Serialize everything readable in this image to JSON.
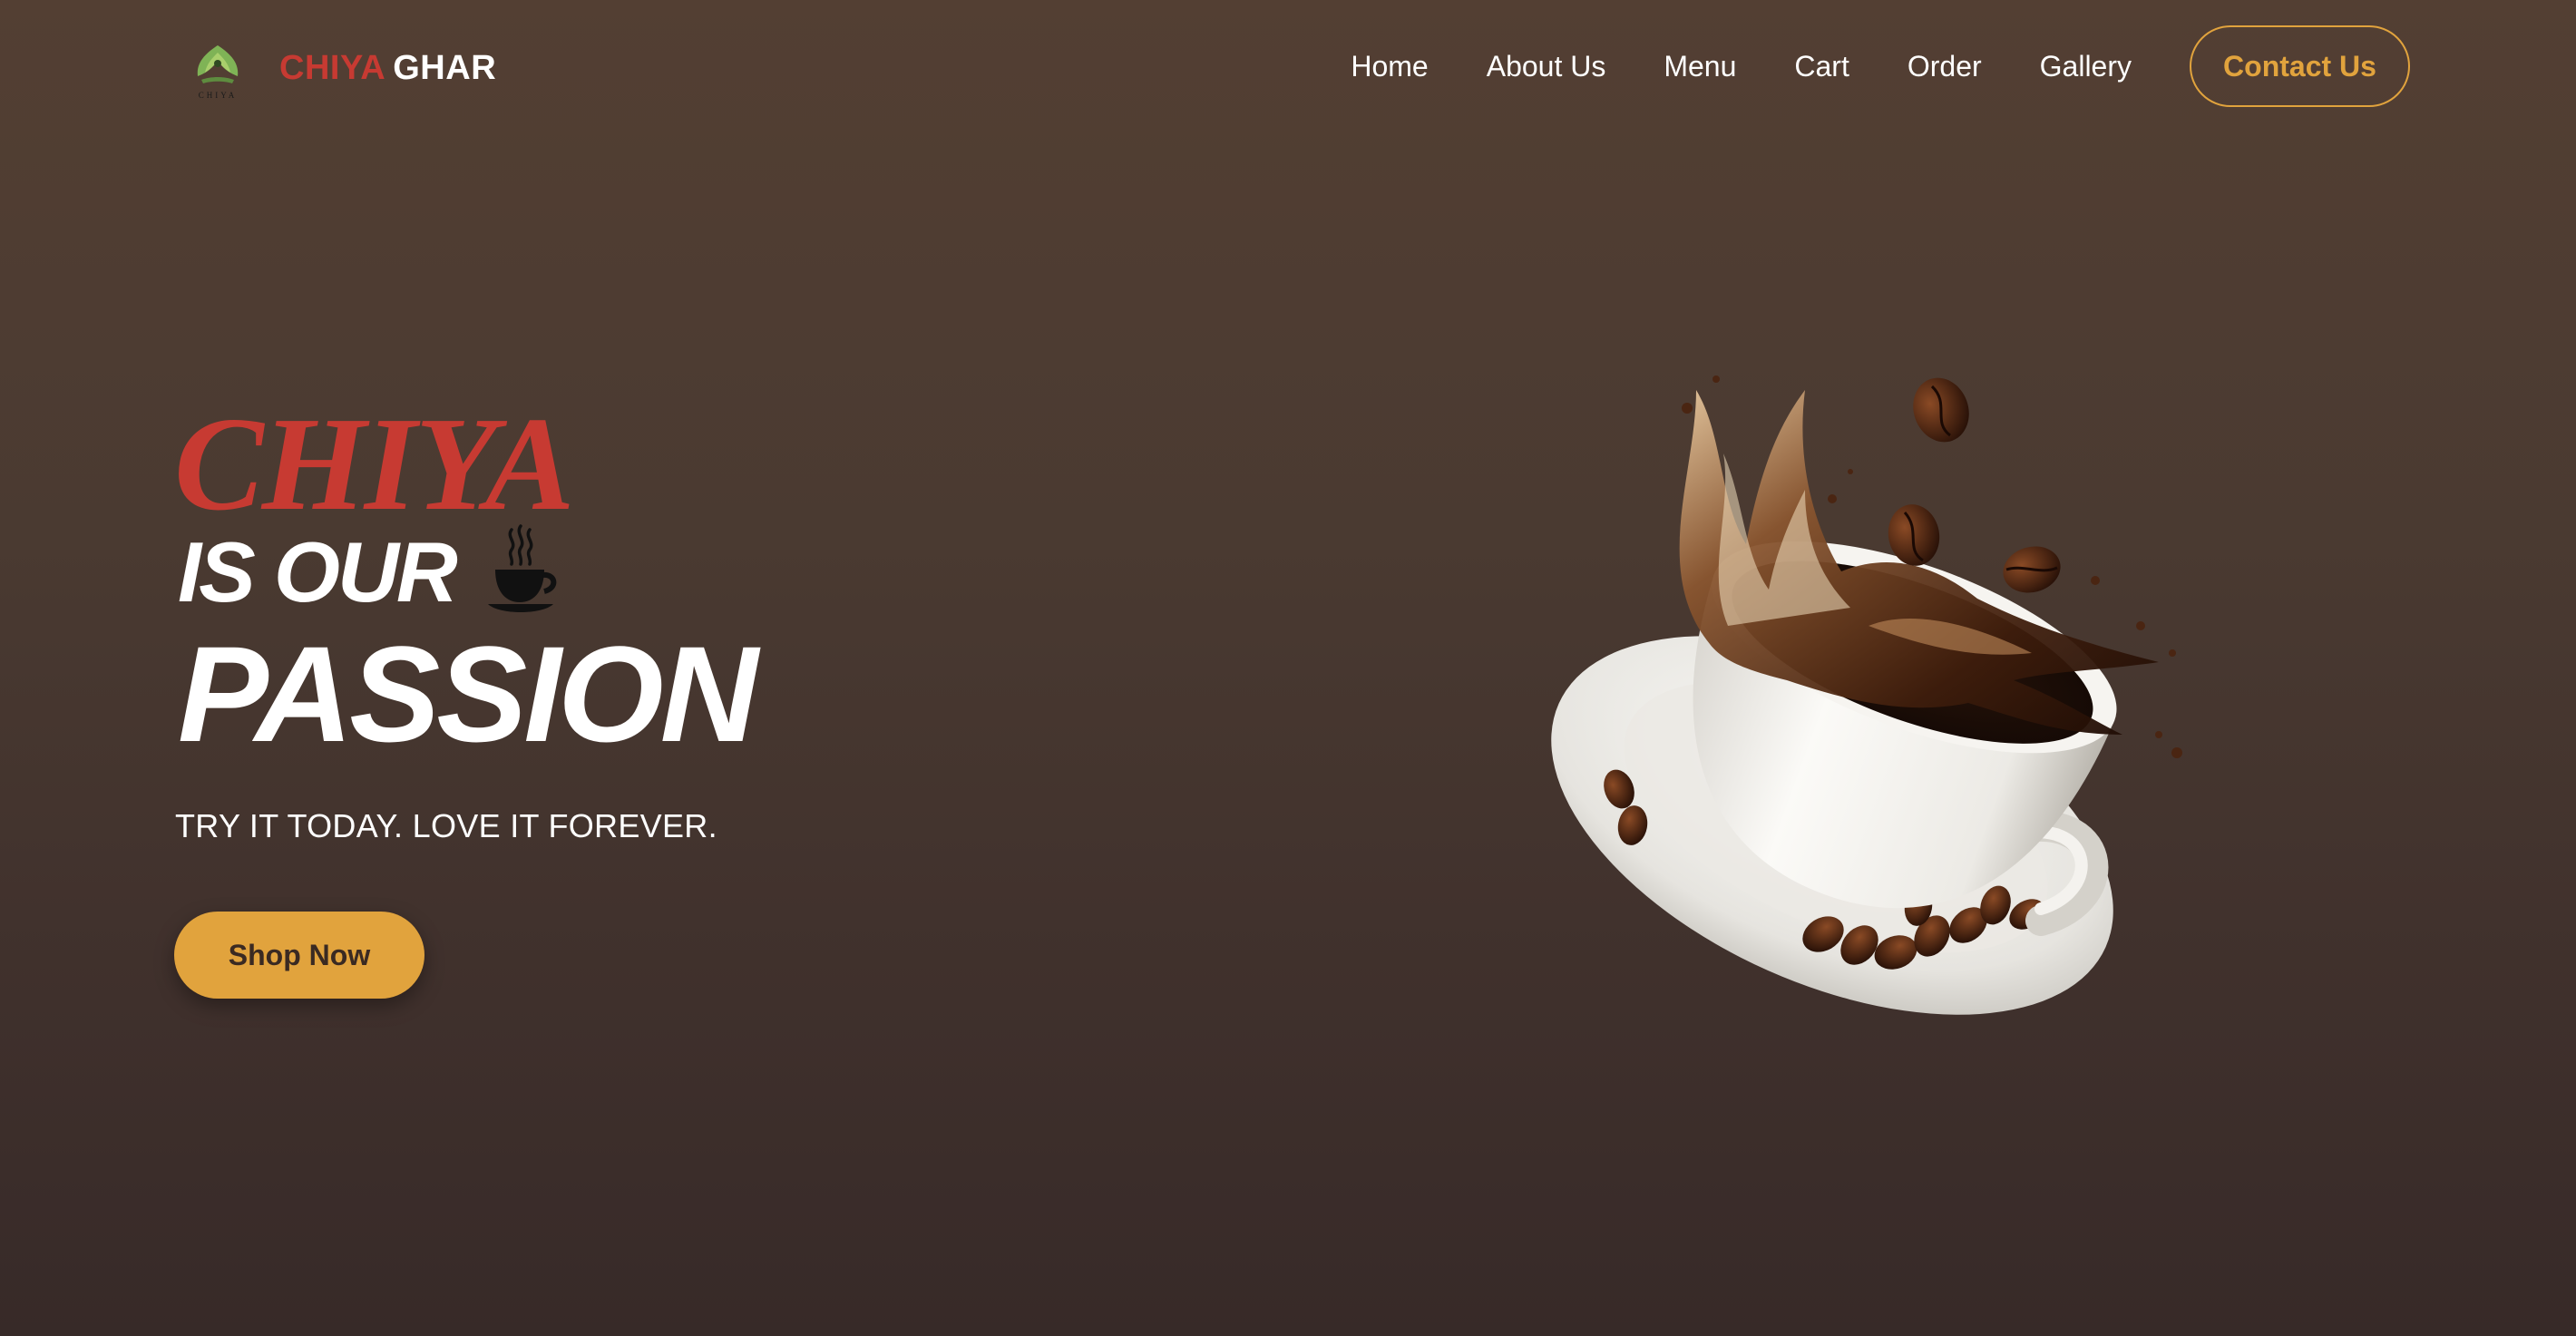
{
  "header": {
    "logo_caption": "CHIYA",
    "brand_part1": "CHIYA",
    "brand_part2": "GHAR",
    "nav_items": [
      "Home",
      "About Us",
      "Menu",
      "Cart",
      "Order",
      "Gallery"
    ],
    "contact_label": "Contact Us"
  },
  "hero": {
    "title_line1": "CHIYA",
    "title_line2": "IS OUR",
    "title_line3": "PASSION",
    "tagline": "TRY IT TODAY. LOVE IT FOREVER.",
    "cta_label": "Shop Now",
    "image_icon": "coffee-splash-image"
  },
  "colors": {
    "brand_red": "#c73a32",
    "accent_gold": "#e1a33d",
    "background_top": "#533f33",
    "background_bottom": "#372a28"
  }
}
